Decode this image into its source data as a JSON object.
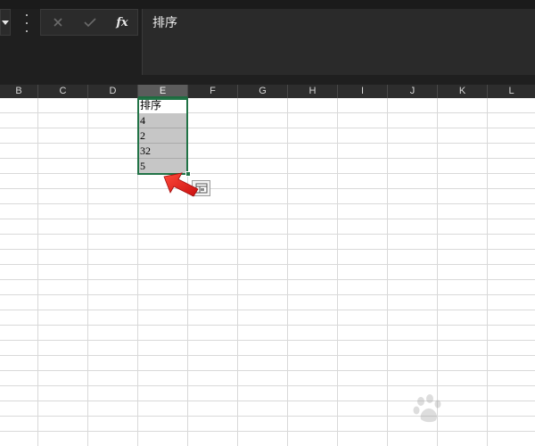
{
  "formula_bar": {
    "formula_text": "排序",
    "cancel_glyph": "✕",
    "enter_glyph": "✓",
    "fx_label": "fx"
  },
  "columns": [
    {
      "id": "B",
      "label": "B"
    },
    {
      "id": "C",
      "label": "C"
    },
    {
      "id": "D",
      "label": "D"
    },
    {
      "id": "E",
      "label": "E",
      "selected": true
    },
    {
      "id": "F",
      "label": "F"
    },
    {
      "id": "G",
      "label": "G"
    },
    {
      "id": "H",
      "label": "H"
    },
    {
      "id": "I",
      "label": "I"
    },
    {
      "id": "J",
      "label": "J"
    },
    {
      "id": "K",
      "label": "K"
    },
    {
      "id": "L",
      "label": "L"
    }
  ],
  "cells": {
    "e1": "排序",
    "e2": "4",
    "e3": "2",
    "e4": "32",
    "e5": "5"
  },
  "colors": {
    "selection_border": "#217346",
    "selection_fill": "#c6c6c6",
    "arrow": "#e8231f",
    "dark_chrome": "#1f1f1f"
  },
  "icons": {
    "name_box_dropdown": "chevron-down-icon",
    "more_options": "more-vertical-icon",
    "cancel": "close-icon",
    "enter": "check-icon",
    "function": "fx-icon",
    "quick_analysis": "quick-analysis-icon",
    "annotation": "red-arrow-icon"
  }
}
